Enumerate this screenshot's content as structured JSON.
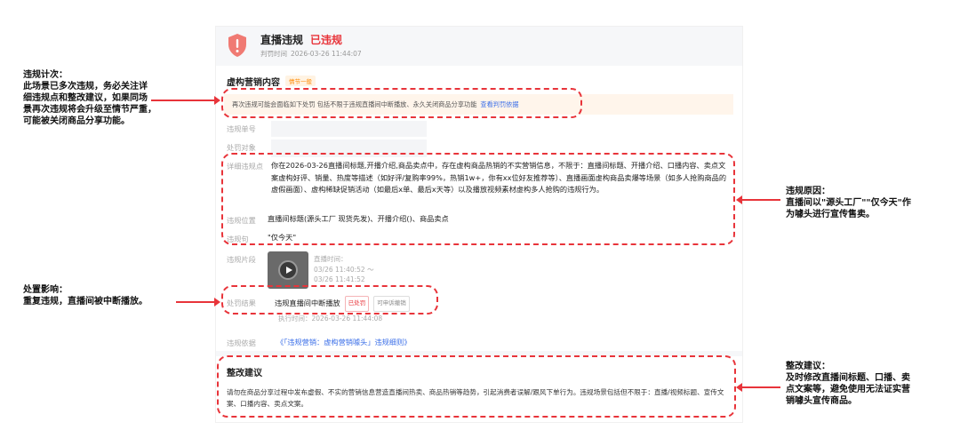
{
  "header": {
    "title": "直播违规",
    "status": "已违规",
    "time_label": "判罚时间",
    "time_value": "2026-03-26 11:44:07"
  },
  "section": {
    "title": "虚构营销内容",
    "tag": "情节一般"
  },
  "warning": {
    "text": "再次违规可能会面临如下处罚 包括不限于违规直播间中断播放、永久关闭商品分享功能",
    "link": "查看判罚依据"
  },
  "fields": {
    "serial_label": "违规单号",
    "target_label": "处罚对象",
    "detail_label": "详细违规点",
    "detail_value": "你在2026-03-26直播间标题,开播介绍,商品卖点中，存在虚构商品热销的不实营销信息，不限于：直播间标题、开播介绍、口播内容、卖点文案虚构好评、销量、热度等描述（如好评/复购率99%，热销1w+，你有xx位好友推荐等）、直播画面虚构商品卖爆等场景（如多人抢购商品的虚假画面）、虚构稀缺促销活动（如最后x单、最后x天等）以及播放视频素材虚构多人抢购的违规行为。",
    "position_label": "违规位置",
    "position_value": "直播间标题(源头工厂 现货先发)、开播介绍()、商品卖点",
    "sentence_label": "违规句",
    "sentence_value": "\"仅今天\"",
    "clip_label": "违规片段",
    "clip_time_label": "直播时间：",
    "clip_time_start": "03/26 11:40:52 ～",
    "clip_time_end": "03/26 11:41:52",
    "result_label": "处罚结果",
    "result_value": "违规直播间中断播放",
    "result_badge": "已处罚",
    "appeal_badge": "可申诉撤销",
    "exec_time": "执行时间：2026-03-26 11:44:08",
    "basis_label": "违规依据",
    "basis_link": "《「违规营销：虚构营销噱头」违规细则》"
  },
  "advice": {
    "title": "整改建议",
    "text": "请勿在商品分享过程中发布虚假、不实的营销信息营造直播间热卖、商品热销等趋势，引起消费者误解/跟风下单行为。违规场景包括但不限于：直播/视频标题、宣传文案、口播内容、卖点文案。"
  },
  "annotations": {
    "left_top": [
      "违规计次：",
      "此场景已多次违规，务必关注详",
      "细违规点和整改建议，如果同场",
      "景再次违规将会升级至情节严重，",
      "可能被关闭商品分享功能。"
    ],
    "left_bottom": [
      "处置影响：",
      "重复违规，直播间被中断播放。"
    ],
    "right_top": [
      "违规原因：",
      "直播间以\"源头工厂\"\"仅今天\"作",
      "为噱头进行宣传售卖。"
    ],
    "right_bottom": [
      "整改建议：",
      "及时修改直播间标题、口播、卖",
      "点文案等，避免使用无法证实营",
      "销噱头宣传商品。"
    ]
  },
  "colors": {
    "accent_red": "#e8343a",
    "link_blue": "#3b6fe8",
    "tag_orange": "#ff8a00"
  }
}
